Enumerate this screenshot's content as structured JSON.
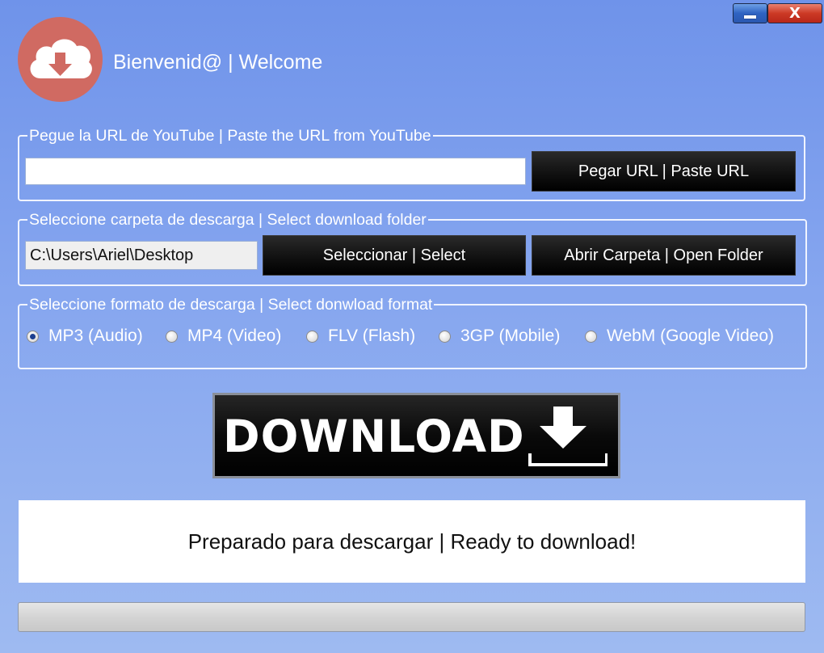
{
  "window": {
    "minimize_icon": "minimize-icon",
    "close_icon": "close-icon",
    "close_glyph": "X"
  },
  "header": {
    "logo_icon": "cloud-download-icon",
    "welcome": "Bienvenid@ | Welcome"
  },
  "url_section": {
    "legend": "Pegue la URL de YouTube | Paste the URL from YouTube",
    "input_value": "",
    "paste_button": "Pegar URL | Paste URL"
  },
  "folder_section": {
    "legend": "Seleccione carpeta de descarga | Select download folder",
    "folder_value": "C:\\Users\\Ariel\\Desktop",
    "select_button": "Seleccionar | Select",
    "open_button": "Abrir Carpeta | Open Folder"
  },
  "format_section": {
    "legend": "Seleccione formato de descarga | Select donwload format",
    "options": [
      {
        "label": "MP3 (Audio)",
        "checked": true
      },
      {
        "label": "MP4 (Video)",
        "checked": false
      },
      {
        "label": "FLV (Flash)",
        "checked": false
      },
      {
        "label": "3GP (Mobile)",
        "checked": false
      },
      {
        "label": "WebM (Google Video)",
        "checked": false
      }
    ]
  },
  "download": {
    "label": "DOWNLOAD",
    "icon": "download-arrow-icon"
  },
  "status": {
    "text": "Preparado para descargar | Ready to download!"
  },
  "progress": {
    "value": 0
  },
  "colors": {
    "background_top": "#6f93ea",
    "background_bottom": "#9ebaf1",
    "logo": "#d06a62",
    "button": "#000000",
    "close": "#cc3a25"
  }
}
